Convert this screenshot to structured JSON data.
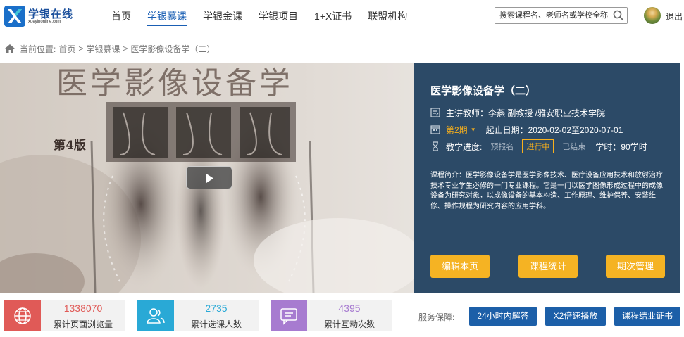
{
  "header": {
    "logo_title": "学银在线",
    "logo_sub": "xueyinonline.com",
    "nav": [
      {
        "label": "首页",
        "active": false
      },
      {
        "label": "学银慕课",
        "active": true
      },
      {
        "label": "学银金课",
        "active": false
      },
      {
        "label": "学银项目",
        "active": false
      },
      {
        "label": "1+X证书",
        "active": false
      },
      {
        "label": "联盟机构",
        "active": false
      }
    ],
    "search_placeholder": "搜索课程名、老师名或学校全称",
    "logout_label": "退出"
  },
  "breadcrumb": {
    "prefix": "当前位置:",
    "items": [
      "首页",
      ">",
      "学银慕课",
      ">",
      "医学影像设备学（二）"
    ]
  },
  "video": {
    "cover_title": "医学影像设备学",
    "cover_edition": "第4版"
  },
  "course": {
    "title": "医学影像设备学（二）",
    "teacher": "主讲教师：李燕 副教授 /雅安职业技术学院",
    "period": "第2期",
    "dates": "起止日期：2020-02-02至2020-07-01",
    "progress_label": "教学进度:",
    "stages": [
      "预报名",
      "进行中",
      "已结束"
    ],
    "current_stage": "进行中",
    "hours": "学时：90学时",
    "intro": "课程简介：医学影像设备学是医学影像技术、医疗设备应用技术和放射治疗技术专业学生必修的一门专业课程。它是一门以医学图像形成过程中的成像设备为研究对象，以成像设备的基本构造、工作原理、维护保养、安装维修、操作规程为研究内容的应用学科。",
    "buttons": [
      "编辑本页",
      "课程统计",
      "期次管理"
    ]
  },
  "stats": [
    {
      "value": "1338070",
      "label": "累计页面浏览量",
      "color": "#e05a57",
      "icon": "globe-icon"
    },
    {
      "value": "2735",
      "label": "累计选课人数",
      "color": "#29a9d6",
      "icon": "users-icon"
    },
    {
      "value": "4395",
      "label": "累计互动次数",
      "color": "#a77bd0",
      "icon": "chat-icon"
    }
  ],
  "guarantee": {
    "label": "服务保障:",
    "buttons": [
      "24小时内解答",
      "X2倍速播放",
      "课程结业证书"
    ]
  }
}
